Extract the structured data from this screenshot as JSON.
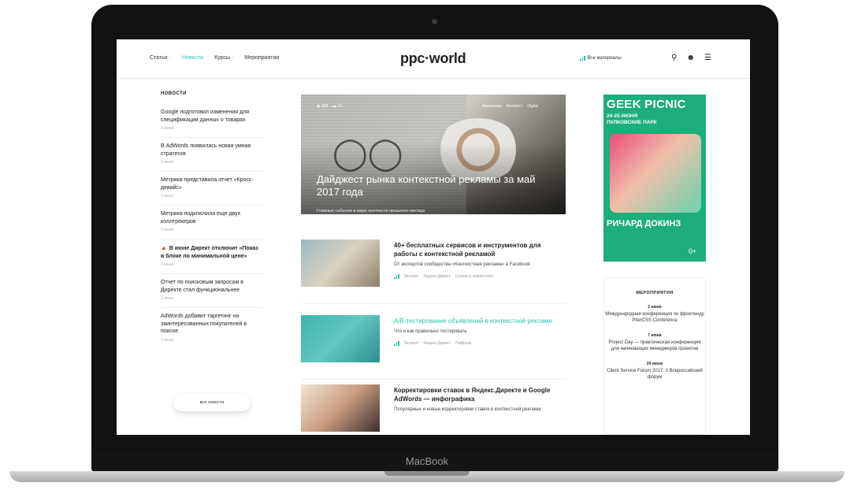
{
  "device": {
    "brand": "MacBook"
  },
  "header": {
    "nav": [
      {
        "label": "Статьи ·",
        "active": false
      },
      {
        "label": "Новости",
        "active": true
      },
      {
        "label": "Курсы ·",
        "active": false
      },
      {
        "label": "Мероприятия",
        "active": false
      }
    ],
    "logo": "ppc·world",
    "all_materials": "Все материалы",
    "icons": [
      "search-icon",
      "user-icon",
      "menu-icon"
    ]
  },
  "news": {
    "title": "НОВОСТИ",
    "items": [
      {
        "title": "Google подготовил изменения для спецификации данных о товарах",
        "date": "2 июня"
      },
      {
        "title": "В AdWords появилась новая умная стратегия",
        "date": "2 июня"
      },
      {
        "title": "Метрика представила отчет «Кросс-девайс»",
        "date": "2 июня"
      },
      {
        "title": "Метрика подключила еще двух коллтрекеров",
        "date": "2 июня"
      },
      {
        "title": "В июне Директ отключит «Показ в блоке по минимальной цене»",
        "date": "2 июня",
        "hot": true
      },
      {
        "title": "Отчет по поисковым запросам в Директе стал функциональнее",
        "date": "2 июня"
      },
      {
        "title": "AdWords добавит таргетинг на заинтересованных покупателей в поиске",
        "date": "2 июня"
      }
    ],
    "all_news_button": "все новости"
  },
  "hero": {
    "meta": [
      "◉ 368",
      "▬ 14"
    ],
    "tags": [
      "Аналитика",
      "Контекст",
      "Digital"
    ],
    "title": "Дайджест рынка контекстной рекламы за май 2017 года",
    "subtitle": "Главные события в мире контекста прошлого месяца"
  },
  "articles": [
    {
      "title": "40+ бесплатных сервисов и инструментов для работы с контекстной рекламой",
      "summary": "От экспертов сообщества «Контекстная реклама» в Facebook",
      "tags": [
        "Эксперт",
        "Яндекс.Директ",
        "Сервисы маркетолог"
      ],
      "highlight": false
    },
    {
      "title": "A/B-тестирование объявлений в контекстной рекламе",
      "summary": "Что и как правильно тестировать",
      "tags": [
        "Эксперт",
        "Яндекс.Директ",
        "Лайфхак"
      ],
      "highlight": true
    },
    {
      "title": "Корректировки ставок в Яндекс.Директе и Google AdWords — инфографика",
      "summary": "Популярные и новые корректировки ставок в контекстной рекламе",
      "tags": [],
      "highlight": false
    }
  ],
  "ad": {
    "headline": "GEEK PICNIC",
    "date_line1": "24-25 ИЮНЯ",
    "date_line2": "ПУЛКОВСКИЕ ПАРК",
    "name": "РИЧАРД ДОКИНЗ",
    "age": "0+"
  },
  "events": {
    "title": "МЕРОПРИЯТИЯ",
    "items": [
      {
        "date": "2 июня",
        "name": "Международная конференция по фронтенду PiterCSS Conference"
      },
      {
        "date": "7 июня",
        "name": "Project Day — практическая конференция для начинающих менеджеров проектов"
      },
      {
        "date": "24 июня",
        "name": "Client Service Forum 2017. II Всероссийский форум"
      }
    ]
  },
  "colors": {
    "accent": "#2bbfb3",
    "ad_green": "#1dae7c",
    "hot": "#e8453c"
  }
}
